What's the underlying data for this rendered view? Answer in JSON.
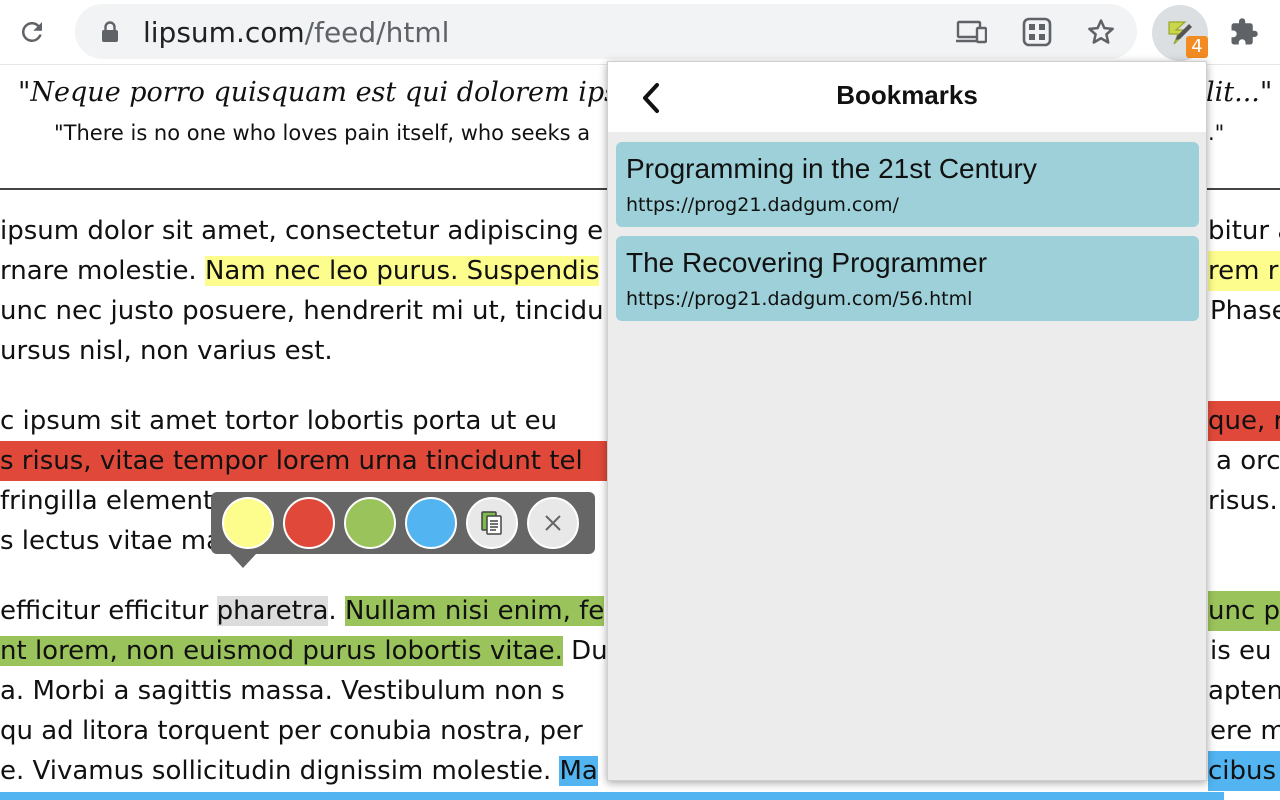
{
  "browser": {
    "url_host": "lipsum.com",
    "url_path": "/feed/html",
    "extension_badge": "4",
    "icons": [
      "reload-icon",
      "lock-icon",
      "cast-icon",
      "qr-icon",
      "star-icon",
      "extension-icon",
      "puzzle-icon"
    ]
  },
  "page": {
    "quote_latin_left": "\"Neque porro quisquam est qui dolorem ipsu",
    "quote_latin_right": "lit...\"",
    "quote_en_left": "\"There is no one who loves pain itself, who seeks a",
    "quote_en_right": ".\"",
    "lines": {
      "l1_left": "ipsum dolor sit amet, consectetur adipiscing e",
      "l1_right": "bitur a",
      "l2_a": "rnare molestie. ",
      "l2_b": "Nam nec leo purus. Suspendis",
      "l2_right": "rem rh",
      "l3_left": "unc nec justo posuere, hendrerit mi ut, tincidu",
      "l3_right": "Phase",
      "l4_left": "ursus nisl, non varius est.",
      "l5_left": "c ipsum sit amet tortor lobortis porta ut eu",
      "l5_right": "que, r",
      "l6_left": "s risus, vitae tempor lorem urna tincidunt tel",
      "l6_right": "a orc",
      "l7_left": "fringilla element",
      "l7_right": "risus.",
      "l8_left": "s lectus vitae ma",
      "l9_a": "efficitur efficitur ",
      "l9_b": "pharetra",
      "l9_c": ". ",
      "l9_d": "Nullam nisi enim, fe",
      "l9_right": "unc pu",
      "l10_a": "nt lorem, non euismod purus lobortis vitae.",
      "l10_b": " Du",
      "l10_right": "is eu",
      "l11_left": "a. Morbi a sagittis massa. Vestibulum non s",
      "l11_right": "apten",
      "l12_left": "qu ad litora torquent per conubia nostra, per",
      "l12_right": "ere m",
      "l13_a": "e. Vivamus sollicitudin dignissim molestie. ",
      "l13_b": "Ma",
      "l13_right": "cibus"
    }
  },
  "highlighter": {
    "colors": [
      "#fdfd8e",
      "#e0493a",
      "#9bc35b",
      "#52b4f1"
    ]
  },
  "bookmarks": {
    "title": "Bookmarks",
    "items": [
      {
        "title": "Programming in the 21st Century",
        "url": "https://prog21.dadgum.com/"
      },
      {
        "title": "The Recovering Programmer",
        "url": "https://prog21.dadgum.com/56.html"
      }
    ]
  }
}
